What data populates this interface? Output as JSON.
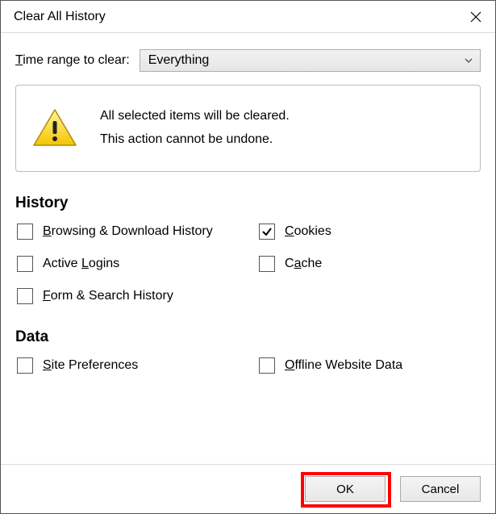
{
  "window": {
    "title": "Clear All History"
  },
  "timerange": {
    "label_before_underline": "",
    "label_underline": "T",
    "label_after_underline": "ime range to clear:",
    "selected": "Everything"
  },
  "warning": {
    "line1": "All selected items will be cleared.",
    "line2": "This action cannot be undone."
  },
  "sections": {
    "history_title": "History",
    "data_title": "Data"
  },
  "checks": {
    "browsing": {
      "pre": "",
      "u": "B",
      "post": "rowsing & Download History",
      "checked": false
    },
    "cookies": {
      "pre": "",
      "u": "C",
      "post": "ookies",
      "checked": true
    },
    "logins": {
      "pre": "Active ",
      "u": "L",
      "post": "ogins",
      "checked": false
    },
    "cache": {
      "pre": "C",
      "u": "a",
      "post": "che",
      "checked": false
    },
    "formsrch": {
      "pre": "",
      "u": "F",
      "post": "orm & Search History",
      "checked": false
    },
    "siteprefs": {
      "pre": "",
      "u": "S",
      "post": "ite Preferences",
      "checked": false
    },
    "offline": {
      "pre": "",
      "u": "O",
      "post": "ffline Website Data",
      "checked": false
    }
  },
  "buttons": {
    "ok": "OK",
    "cancel": "Cancel"
  },
  "highlight": {
    "target": "ok"
  }
}
